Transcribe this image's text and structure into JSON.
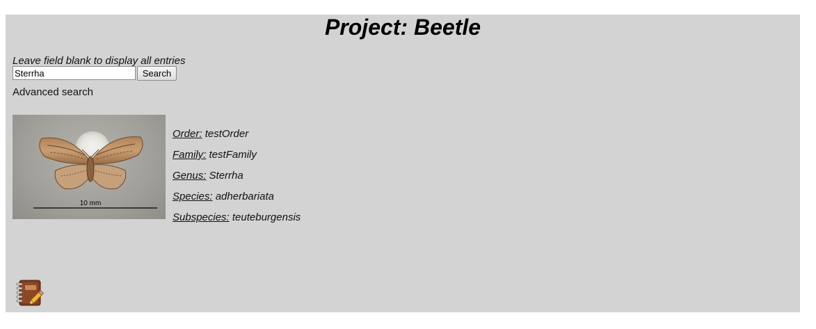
{
  "header": {
    "title": "Project: Beetle"
  },
  "search": {
    "hint": "Leave field blank to display all entries",
    "value": "Sterrha",
    "button_label": "Search",
    "advanced_label": "Advanced search"
  },
  "specimen": {
    "scale_label": "10 mm"
  },
  "taxonomy": [
    {
      "label": "Order:",
      "value": "testOrder"
    },
    {
      "label": "Family:",
      "value": "testFamily"
    },
    {
      "label": "Genus:",
      "value": "Sterrha"
    },
    {
      "label": "Species:",
      "value": "adherbariata"
    },
    {
      "label": "Subspecies:",
      "value": "teuteburgensis"
    }
  ],
  "footer": {
    "icon": "notebook-edit-icon"
  },
  "colors": {
    "page_background": "#d3d3d3",
    "outer_background": "#ffffff"
  }
}
